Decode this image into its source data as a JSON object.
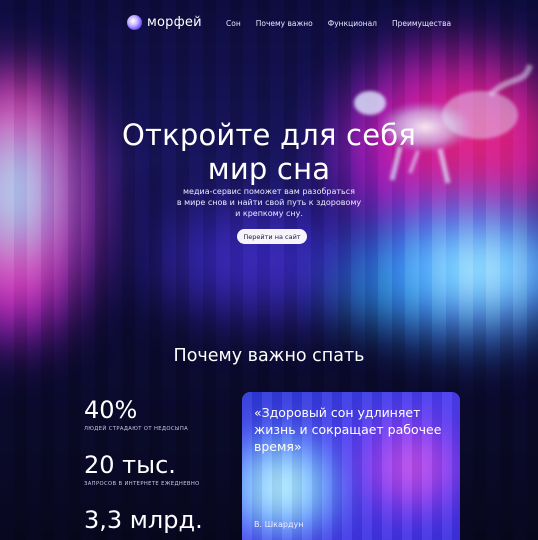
{
  "brand": {
    "name": "морфей",
    "logo_icon": "sphere-logo-icon"
  },
  "nav": {
    "items": [
      "Сон",
      "Почему важно",
      "Функционал",
      "Преимущества"
    ]
  },
  "hero": {
    "title_line1": "Откройте для себя",
    "title_line2": "мир сна",
    "subtitle_line1": "медиа-сервис поможет вам разобраться",
    "subtitle_line2": "в мире снов и найти свой путь к здоровому",
    "subtitle_line3": "и крепкому сну.",
    "cta_label": "Перейти на сайт",
    "illustration": "glowing-sheep-icon"
  },
  "why": {
    "title": "Почему важно спать",
    "stats": [
      {
        "value": "40%",
        "label": "ЛЮДЕЙ СТРАДАЮТ ОТ НЕДОСЫПА"
      },
      {
        "value": "20 тыс.",
        "label": "ЗАПРОСОВ В ИНТЕРНЕТЕ ЕЖЕДНЕВНО"
      },
      {
        "value": "3,3 млрд."
      }
    ],
    "quote": {
      "text": "«Здоровый сон удлиняет жизнь и сокращает рабочее время»",
      "author": "В. Шкардун"
    }
  },
  "colors": {
    "background": "#0d0c3d",
    "accent_pink": "#ff2fa0",
    "accent_blue": "#2e7bff",
    "cta_bg": "#f6f3fb"
  }
}
